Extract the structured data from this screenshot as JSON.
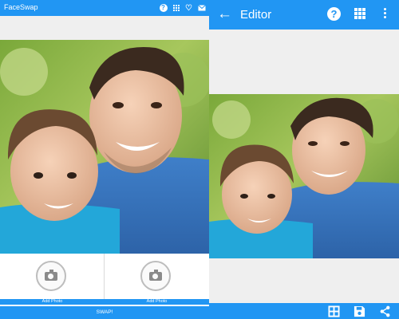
{
  "left_screen": {
    "app_title": "FaceSwap",
    "toolbar_icons": [
      "help-icon",
      "grid-icon",
      "heart-icon",
      "mail-icon"
    ],
    "photo_slots": [
      {
        "label": "Add Photo",
        "icon": "camera-icon"
      },
      {
        "label": "Add Photo",
        "icon": "camera-icon"
      }
    ],
    "swap_label": "SWAP!"
  },
  "right_screen": {
    "title": "Editor",
    "toolbar_icons": [
      "back-arrow-icon",
      "help-icon",
      "grid-icon",
      "more-vert-icon"
    ],
    "bottom_actions": [
      "grid-layout-icon",
      "save-icon",
      "share-icon"
    ]
  },
  "colors": {
    "primary": "#2196f3",
    "background": "#efefef",
    "surface": "#ffffff"
  }
}
